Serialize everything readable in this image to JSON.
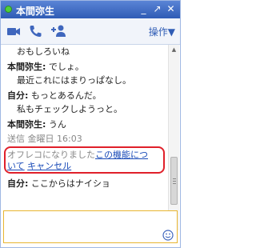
{
  "window": {
    "title": "本間弥生",
    "minimize_glyph": "_",
    "popout_glyph": "↗",
    "close_glyph": "✕"
  },
  "toolbar": {
    "video_icon": "video-camera-icon",
    "call_icon": "phone-icon",
    "add_person_icon": "add-person-icon",
    "menu_label": "操作▼"
  },
  "chat": {
    "messages": [
      {
        "text": "おもしろいね"
      },
      {
        "speaker": "本間弥生:",
        "text": "でしょ。"
      },
      {
        "text": "最近これにはまりっぱなし。"
      },
      {
        "speaker": "自分:",
        "text": "もっとあるんだ。"
      },
      {
        "text": "私もチェックしようっと。"
      },
      {
        "speaker": "本間弥生:",
        "text": "うん"
      },
      {
        "text": "送信 金曜日 16:03"
      },
      {
        "speaker": "自分:",
        "text": "ここからはナイショ"
      }
    ],
    "offrecord": {
      "text": "オフレコになりました",
      "link1_line1": "この機能につ",
      "link1_line2": "いて",
      "link2": "キャンセル"
    }
  },
  "input": {
    "value": "",
    "emoji_icon": "smiley-icon"
  },
  "colors": {
    "titlebar": "#3d6bc4",
    "accent_link": "#1a4bb8",
    "highlight_border": "#e0202a",
    "input_border": "#e8b530",
    "status_online": "#4fcf3a"
  }
}
